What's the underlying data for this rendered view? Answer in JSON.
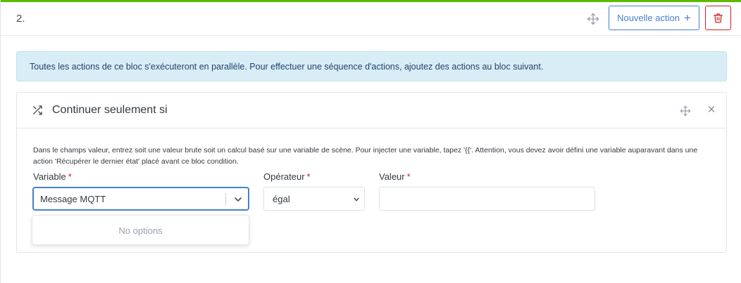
{
  "block": {
    "index": "2.",
    "new_action_label": "Nouvelle action",
    "accent_color": "#5eba00"
  },
  "info": {
    "message": "Toutes les actions de ce bloc s'exécuteront en parallèle. Pour effectuer une séquence d'actions, ajoutez des actions au bloc suivant."
  },
  "action": {
    "title": "Continuer seulement si",
    "help": "Dans le champs valeur, entrez soit une valeur brute soit un calcul basé sur une variable de scène. Pour injecter une variable, tapez '{{'. Attention, vous devez avoir défini une variable auparavant dans une action 'Récupérer le dernier état' placé avant ce bloc condition.",
    "fields": {
      "variable_label": "Variable",
      "operator_label": "Opérateur",
      "value_label": "Valeur",
      "required_mark": "*",
      "variable_value": "Message MQTT",
      "operator_value": "égal",
      "value_value": ""
    },
    "dropdown": {
      "empty_text": "No options"
    }
  },
  "icons": {
    "drag": "move-arrows-icon",
    "plus": "plus-icon",
    "delete": "trash-icon",
    "shuffle": "shuffle-icon",
    "close": "close-icon",
    "chevron": "chevron-down-icon"
  },
  "colors": {
    "primary": "#467fcf",
    "danger": "#cd201f",
    "info_bg": "#d9edf7"
  }
}
